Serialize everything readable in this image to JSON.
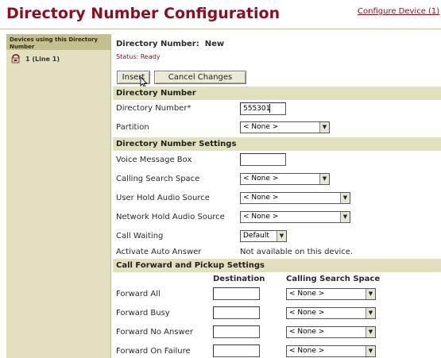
{
  "page": {
    "title": "Directory Number Configuration",
    "top_link": "Configure Device (1)"
  },
  "sidebar": {
    "heading": "Devices using this Directory Number",
    "items": [
      {
        "label": "1 (Line 1)",
        "icon": "phone-line-icon"
      }
    ]
  },
  "header": {
    "dn_label": "Directory Number:",
    "dn_value": "New",
    "status": "Status:  Ready"
  },
  "buttons": {
    "insert": "Insert",
    "cancel": "Cancel Changes"
  },
  "sections": {
    "dn": "Directory Number",
    "dn_settings": "Directory Number Settings",
    "forward": "Call Forward and Pickup Settings"
  },
  "dn_section": {
    "dn_label": "Directory Number*",
    "dn_value": "555301",
    "partition_label": "Partition",
    "partition_value": "< None >"
  },
  "settings": {
    "voice_mail_label": "Voice Message Box",
    "voice_mail_value": "",
    "css_label": "Calling Search Space",
    "css_value": "< None >",
    "user_hold_label": "User Hold Audio Source",
    "user_hold_value": "< None >",
    "network_hold_label": "Network Hold Audio Source",
    "network_hold_value": "< None >",
    "call_waiting_label": "Call Waiting",
    "call_waiting_value": "Default",
    "auto_answer_label": "Activate Auto Answer",
    "auto_answer_value": "Not available on this device."
  },
  "forward": {
    "col_destination": "Destination",
    "col_css": "Calling Search Space",
    "rows": [
      {
        "label": "Forward All",
        "destination": "",
        "css": "< None >"
      },
      {
        "label": "Forward Busy",
        "destination": "",
        "css": "< None >"
      },
      {
        "label": "Forward No Answer",
        "destination": "",
        "css": "< None >"
      },
      {
        "label": "Forward On Failure",
        "destination": "",
        "css": "< None >"
      }
    ]
  },
  "colors": {
    "title": "#8b0f1e",
    "section_bg": "#e2e0bf",
    "sidebar_bg": "#e2e0bf",
    "sidebar_header_bg": "#c2c08d"
  }
}
